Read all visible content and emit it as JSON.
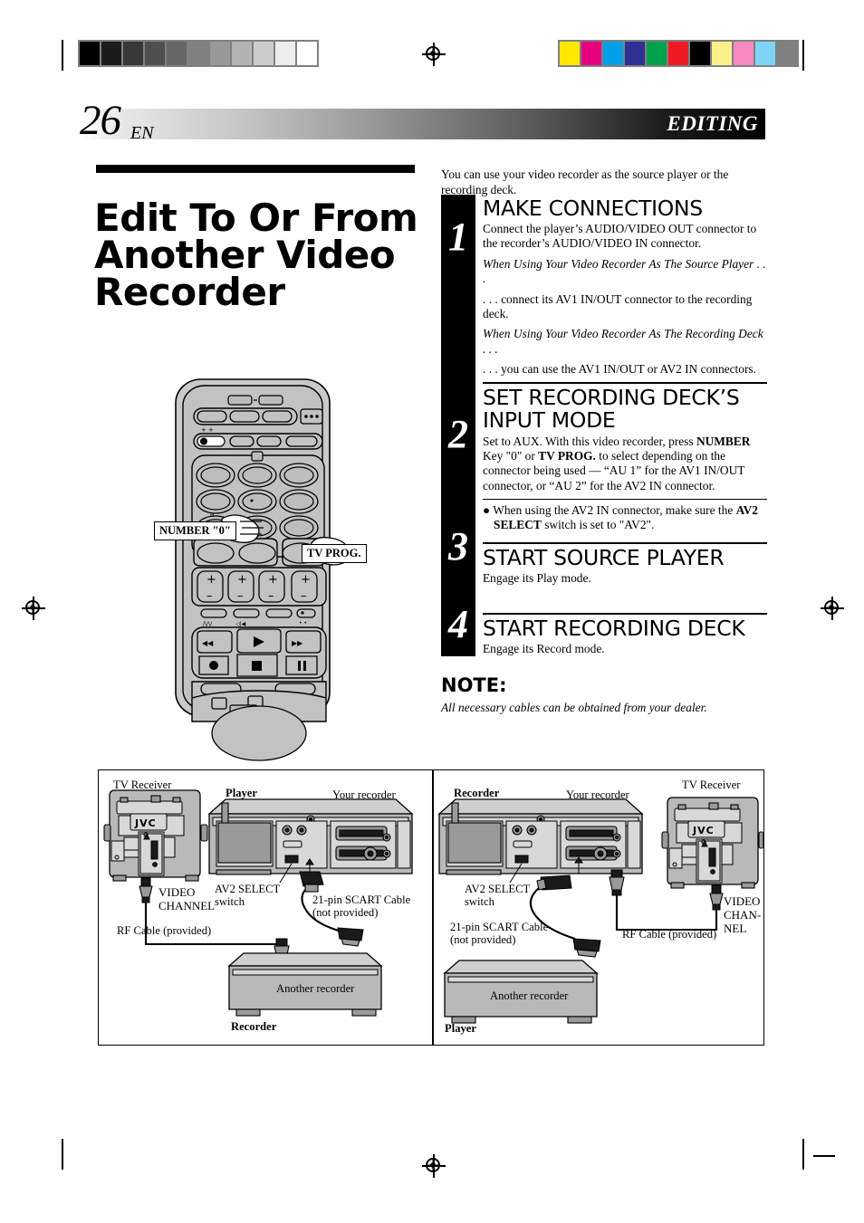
{
  "print_marks": {
    "grayscale_swatches": [
      "#000000",
      "#1c1c1c",
      "#383838",
      "#4f4f4f",
      "#666666",
      "#808080",
      "#999999",
      "#b3b3b3",
      "#cccccc",
      "#ededed",
      "#ffffff"
    ],
    "color_swatches": [
      "#ffe800",
      "#e6007e",
      "#00a0e9",
      "#2e3192",
      "#00a14b",
      "#ed1c24",
      "#000000",
      "#fbf08a",
      "#f589c0",
      "#7fd4f5",
      "#808080"
    ],
    "registration_icon": "registration-target-icon"
  },
  "header": {
    "page_number": "26",
    "language_code": "EN",
    "section": "EDITING"
  },
  "title": "Edit To Or From Another Video Recorder",
  "intro": "You can use your video recorder as the source player or the recording deck.",
  "steps": [
    {
      "number": "1",
      "heading": "MAKE CONNECTIONS",
      "paragraphs": [
        {
          "style": "normal",
          "text": "Connect the player’s AUDIO/VIDEO OUT connector to the recorder’s AUDIO/VIDEO IN connector."
        },
        {
          "style": "italic",
          "text": "When Using Your Video Recorder As The Source Player . . ."
        },
        {
          "style": "normal",
          "text": ". . . connect its AV1 IN/OUT connector to the recording deck."
        },
        {
          "style": "italic",
          "text": "When Using Your Video Recorder As The Recording Deck . . ."
        },
        {
          "style": "normal",
          "text": " . . . you can use the AV1 IN/OUT or AV2 IN connectors."
        }
      ]
    },
    {
      "number": "2",
      "heading": "SET RECORDING DECK’S INPUT MODE",
      "body_html": "Set to AUX. With this video recorder, press <b>NUMBER</b> Key \"0\" or <b>TV PROG.</b> to select depending on the connector being used — “AU 1” for the AV1 IN/OUT connector, or “AU 2” for the AV2 IN connector.",
      "bullet_html": "● When using the AV2 IN connector, make sure the <b>AV2 SELECT</b> switch is set to \"AV2\"."
    },
    {
      "number": "3",
      "heading": "START SOURCE PLAYER",
      "paragraphs": [
        {
          "style": "normal",
          "text": "Engage its Play mode."
        }
      ]
    },
    {
      "number": "4",
      "heading": "START RECORDING DECK",
      "paragraphs": [
        {
          "style": "normal",
          "text": "Engage its Record mode."
        }
      ]
    }
  ],
  "note": {
    "heading": "NOTE:",
    "text": "All necessary cables can be obtained from your dealer."
  },
  "remote_callouts": {
    "number_zero": "NUMBER \"0\"",
    "tv_prog": "TV PROG."
  },
  "diagram": {
    "left_panel": {
      "tv_receiver": "TV Receiver",
      "tv_brand": "JVC",
      "player_role": "Player",
      "your_recorder": "Your recorder",
      "av2_select": "AV2 SELECT switch",
      "video_channel": "VIDEO CHANNEL",
      "rf_cable": "RF Cable (provided)",
      "scart_cable": "21-pin SCART Cable (not provided)",
      "another_recorder": "Another recorder",
      "recorder_role": "Recorder"
    },
    "right_panel": {
      "recorder_role": "Recorder",
      "your_recorder": "Your recorder",
      "tv_receiver": "TV Receiver",
      "tv_brand": "JVC",
      "av2_select": "AV2 SELECT switch",
      "scart_cable": "21-pin SCART Cable (not provided)",
      "rf_cable": "RF Cable (provided)",
      "video_channel": "VIDEO CHAN- NEL",
      "another_recorder": "Another recorder",
      "player_role": "Player"
    }
  }
}
